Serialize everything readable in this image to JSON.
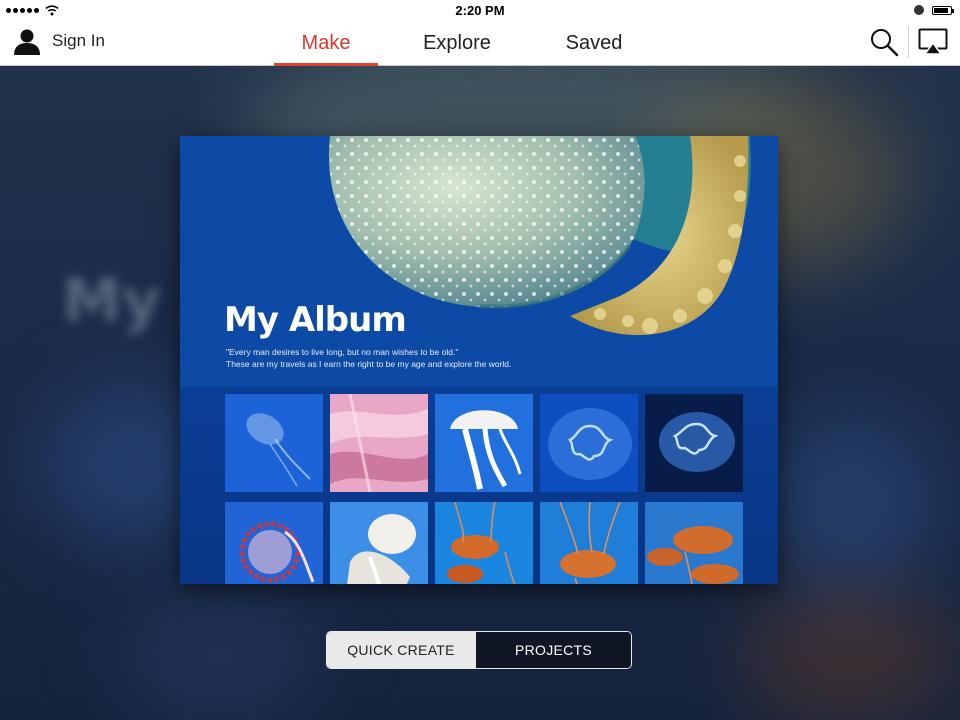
{
  "status_bar": {
    "time": "2:20 PM",
    "battery_level": 0.85
  },
  "nav": {
    "sign_in_label": "Sign In",
    "tabs": [
      {
        "label": "Make",
        "active": true
      },
      {
        "label": "Explore",
        "active": false
      },
      {
        "label": "Saved",
        "active": false
      }
    ],
    "icons": [
      "user-icon",
      "search-icon",
      "airplay-icon"
    ],
    "accent_color": "#e0412f"
  },
  "album": {
    "title": "My Album",
    "quote_line1": "\"Every man desires to live long, but no man wishes to be old.\"",
    "quote_line2": "These are my travels as I earn the right to be my age and explore the world.",
    "background_color": "#0d49a4"
  },
  "bottom_control": {
    "quick_create_label": "QUICK CREATE",
    "projects_label": "PROJECTS"
  }
}
